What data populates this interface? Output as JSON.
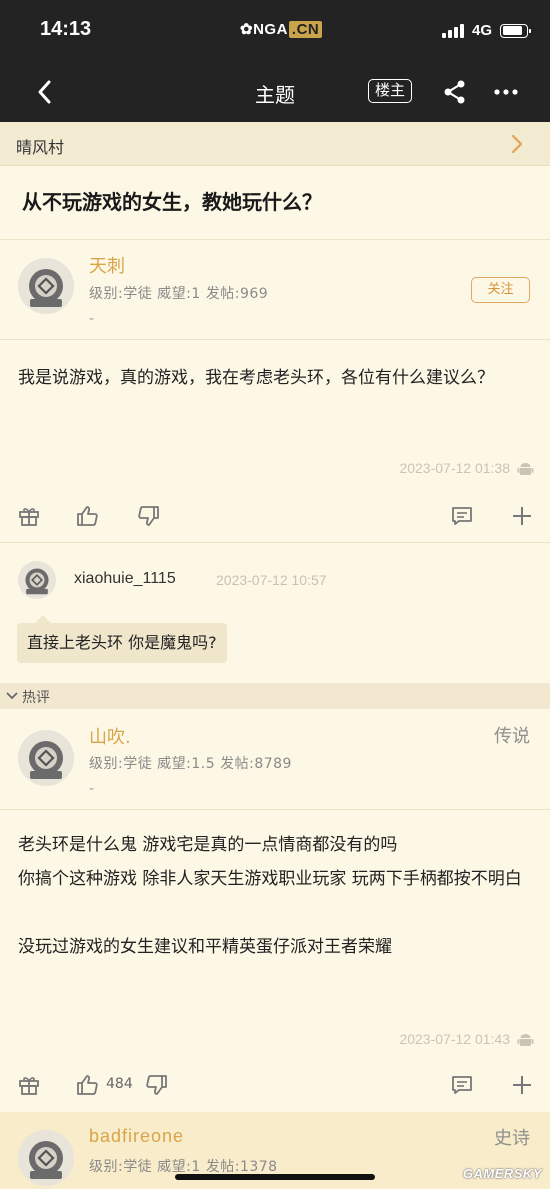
{
  "status_bar": {
    "time": "14:13",
    "logo_main": "NGA",
    "logo_cn": ".CN",
    "network": "4G",
    "battery_level": 0.85
  },
  "nav": {
    "title": "主题",
    "louzhu_label": "楼主",
    "back_icon": "chevron-left-icon",
    "share_icon": "share-icon",
    "more_icon": "more-icon"
  },
  "forum": {
    "name": "晴风村"
  },
  "topic": {
    "title": "从不玩游戏的女生，教她玩什么？"
  },
  "posts": [
    {
      "username": "天刺",
      "meta": "级别:学徒  威望:1  发帖:969",
      "extra": "-",
      "follow_label": "关注",
      "body": "我是说游戏，真的游戏，我在考虑老头环，各位有什么建议么？",
      "timestamp": "2023-07-12 01:38",
      "reply": {
        "username": "xiaohuie_1115",
        "time": "2023-07-12 10:57",
        "text": "直接上老头环 你是魔鬼吗?"
      }
    },
    {
      "username": "山吹.",
      "rank": "传说",
      "meta": "级别:学徒  威望:1.5  发帖:8789",
      "extra": "-",
      "body": "老头环是什么鬼 游戏宅是真的一点情商都没有的吗\n你搞个这种游戏 除非人家天生游戏职业玩家 玩两下手柄都按不明白\n\n没玩过游戏的女生建议和平精英蛋仔派对王者荣耀",
      "timestamp": "2023-07-12 01:43",
      "likes": "484"
    },
    {
      "username": "badfireone",
      "rank": "史诗",
      "meta": "级别:学徒  威望:1  发帖:1378"
    }
  ],
  "hot_label": "热评",
  "watermark": "GAMERSKY"
}
